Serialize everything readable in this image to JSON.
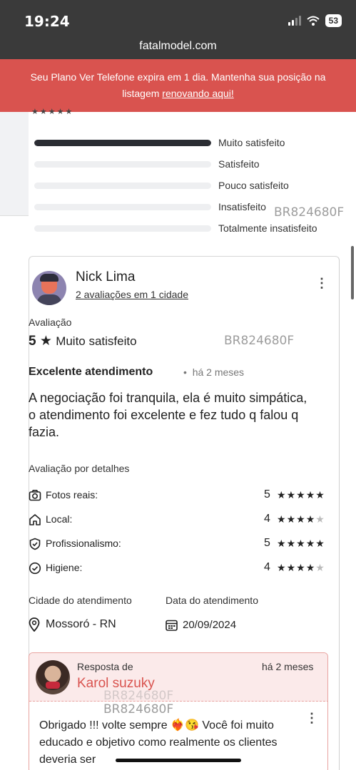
{
  "status_bar": {
    "time": "19:24",
    "battery": "53"
  },
  "browser": {
    "url": "fatalmodel.com"
  },
  "banner": {
    "text": "Seu Plano Ver Telefone expira em 1 dia. Mantenha sua posição na listagem",
    "link": "renovando aqui!"
  },
  "rating_distribution": [
    {
      "label": "Muito satisfeito",
      "fill": 1.0
    },
    {
      "label": "Satisfeito",
      "fill": 0
    },
    {
      "label": "Pouco satisfeito",
      "fill": 0
    },
    {
      "label": "Insatisfeito",
      "fill": 0
    },
    {
      "label": "Totalmente insatisfeito",
      "fill": 0
    }
  ],
  "watermark": "BR824680F",
  "review": {
    "reviewer_name": "Nick Lima",
    "reviewer_sub": "2 avaliações em 1 cidade",
    "rating_label": "Avaliação",
    "rating_value": "5",
    "rating_star": "★",
    "rating_text": "Muito satisfeito",
    "title": "Excelente atendimento",
    "time": "há 2 meses",
    "body": "A negociação foi tranquila, ela é muito simpática, o atendimento foi excelente e fez tudo q falou q fazia.",
    "details_label": "Avaliação por detalhes",
    "details": [
      {
        "name": "Fotos reais:",
        "value": "5",
        "stars": 5,
        "icon": "camera-icon"
      },
      {
        "name": "Local:",
        "value": "4",
        "stars": 4,
        "icon": "home-icon"
      },
      {
        "name": "Profissionalismo:",
        "value": "5",
        "stars": 5,
        "icon": "shield-check-icon"
      },
      {
        "name": "Higiene:",
        "value": "4",
        "stars": 4,
        "icon": "check-circle-icon"
      }
    ],
    "city_label": "Cidade do atendimento",
    "city_value": "Mossoró - RN",
    "date_label": "Data do atendimento",
    "date_value": "20/09/2024"
  },
  "reply": {
    "label": "Resposta de",
    "time": "há 2 meses",
    "name": "Karol suzuky",
    "text": "Obrigado !!! volte sempre ❤️‍🔥😘 Você foi muito educado e objetivo como realmente os clientes deveria ser"
  }
}
